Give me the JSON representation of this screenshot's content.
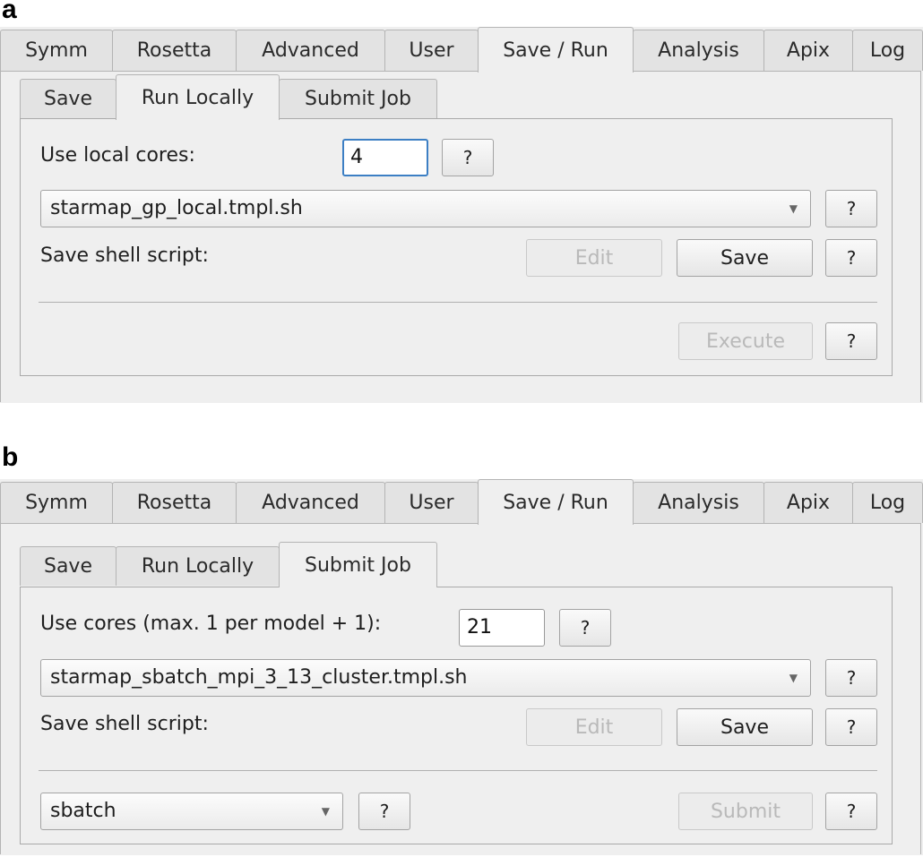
{
  "panel_a": {
    "label": "a",
    "top_tabs": [
      "Symm",
      "Rosetta",
      "Advanced",
      "User",
      "Save / Run",
      "Analysis",
      "Apix",
      "Log"
    ],
    "sub_tabs": [
      "Save",
      "Run Locally",
      "Submit Job"
    ],
    "cores_label": "Use local cores:",
    "cores_value": "4",
    "template_value": "starmap_gp_local.tmpl.sh",
    "save_script_label": "Save shell script:",
    "edit_label": "Edit",
    "save_label": "Save",
    "action_label": "Execute",
    "help_label": "?"
  },
  "panel_b": {
    "label": "b",
    "top_tabs": [
      "Symm",
      "Rosetta",
      "Advanced",
      "User",
      "Save / Run",
      "Analysis",
      "Apix",
      "Log"
    ],
    "sub_tabs": [
      "Save",
      "Run Locally",
      "Submit Job"
    ],
    "cores_label": "Use cores (max. 1 per model + 1):",
    "cores_value": "21",
    "template_value": "starmap_sbatch_mpi_3_13_cluster.tmpl.sh",
    "save_script_label": "Save shell script:",
    "edit_label": "Edit",
    "save_label": "Save",
    "scheduler_value": "sbatch",
    "action_label": "Submit",
    "help_label": "?"
  },
  "colors": {
    "focus": "#3c7fc4",
    "panel_bg": "#efefef",
    "disabled_text": "#b9b9b9"
  },
  "icons": {
    "dropdown": "chevron-down-icon"
  }
}
